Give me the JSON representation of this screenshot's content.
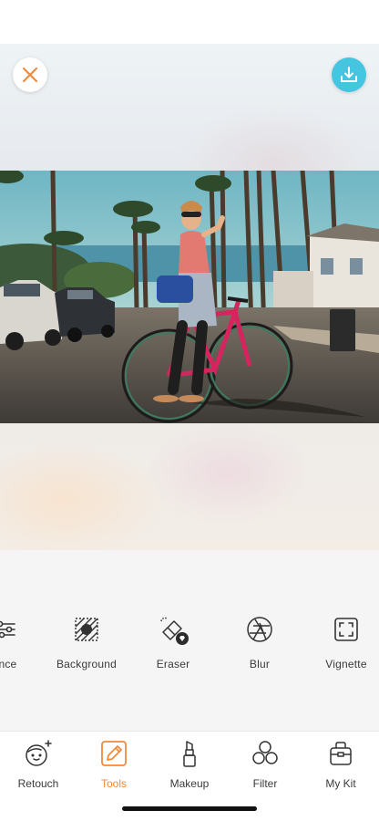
{
  "editor": {
    "close_icon": "close-icon",
    "download_icon": "download-icon",
    "photo_subject": "photo"
  },
  "tools": [
    {
      "id": "balance",
      "label": "ance",
      "icon": "sliders-icon"
    },
    {
      "id": "background",
      "label": "Background",
      "icon": "background-icon"
    },
    {
      "id": "eraser",
      "label": "Eraser",
      "icon": "eraser-icon"
    },
    {
      "id": "blur",
      "label": "Blur",
      "icon": "aperture-icon"
    },
    {
      "id": "vignette",
      "label": "Vignette",
      "icon": "vignette-icon"
    }
  ],
  "tabs": [
    {
      "id": "retouch",
      "label": "Retouch",
      "icon": "face-sparkle-icon",
      "active": false
    },
    {
      "id": "tools",
      "label": "Tools",
      "icon": "pencil-icon",
      "active": true
    },
    {
      "id": "makeup",
      "label": "Makeup",
      "icon": "lipstick-icon",
      "active": false
    },
    {
      "id": "filter",
      "label": "Filter",
      "icon": "circles-icon",
      "active": false
    },
    {
      "id": "mykit",
      "label": "My Kit",
      "icon": "kit-bag-icon",
      "active": false
    }
  ],
  "colors": {
    "accent": "#f08a3c",
    "download": "#44c6e0",
    "panel": "#f5f5f5"
  }
}
